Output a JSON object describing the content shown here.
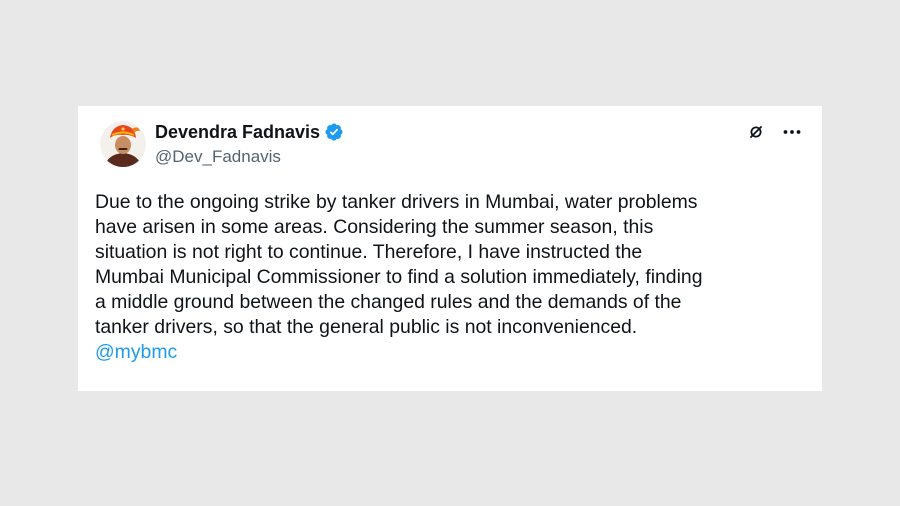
{
  "tweet": {
    "author_name": "Devendra Fadnavis",
    "author_handle": "@Dev_Fadnavis",
    "verified": true,
    "body_lines": [
      "Due to the ongoing strike by tanker drivers in Mumbai, water problems",
      "have arisen in some areas. Considering the summer season, this",
      "situation is not right to continue. Therefore, I have instructed the",
      "Mumbai Municipal Commissioner to find a solution immediately, finding",
      "a middle ground between the changed rules and the demands of the",
      "tanker drivers, so that the general public is not inconvenienced."
    ],
    "mention": "@mybmc"
  },
  "icons": {
    "verified": "verified-badge-icon",
    "grok": "grok-icon",
    "more": "more-options-icon"
  },
  "colors": {
    "background": "#e8e8e8",
    "card": "#ffffff",
    "text": "#0f1419",
    "secondary": "#536471",
    "accent": "#1d9bf0"
  }
}
